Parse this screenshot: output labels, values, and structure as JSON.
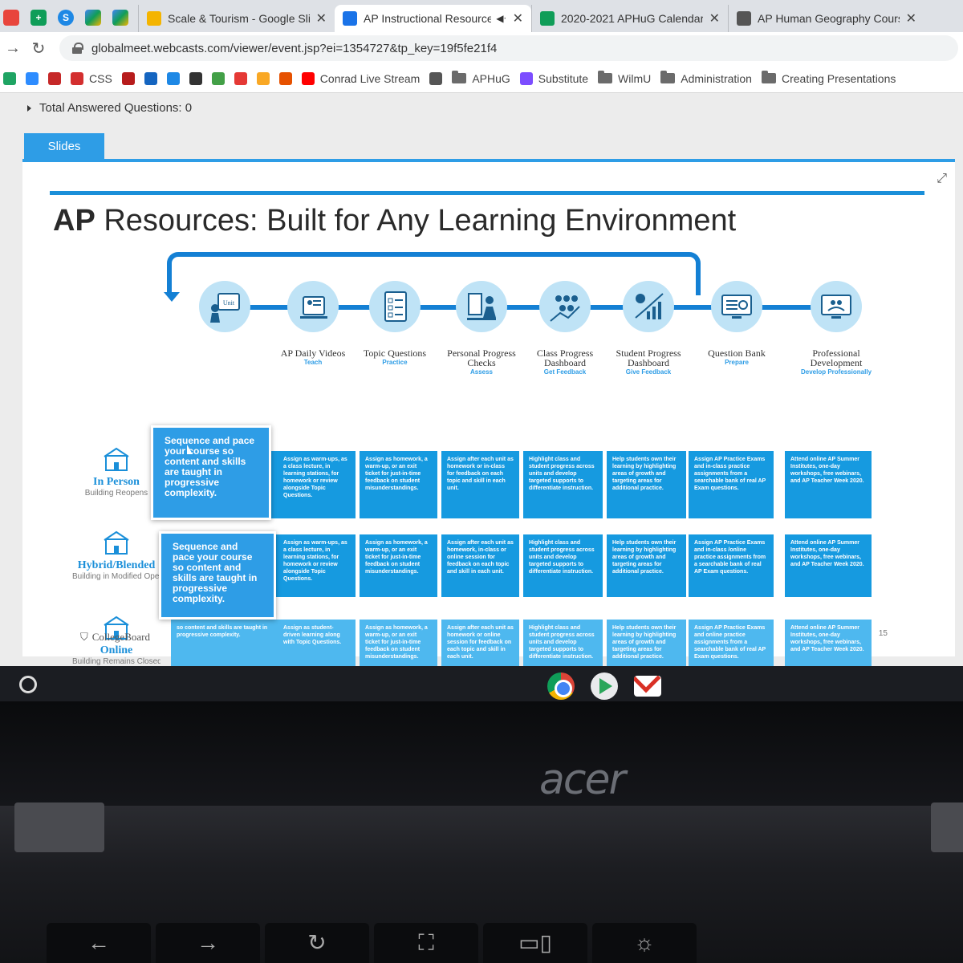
{
  "browser": {
    "tabs": [
      {
        "title": "Scale & Tourism - Google Slides",
        "icon": "slides-icon",
        "color": "#f4b400",
        "active": false
      },
      {
        "title": "AP Instructional Resources",
        "icon": "wifi-icon",
        "color": "#1a73e8",
        "active": true
      },
      {
        "title": "2020-2021 APHuG Calendar",
        "icon": "sheets-icon",
        "color": "#0f9d58",
        "active": false
      },
      {
        "title": "AP Human Geography Course",
        "icon": "collegeboard-icon",
        "color": "#555555",
        "active": false
      }
    ],
    "url": "globalmeet.webcasts.com/viewer/event.jsp?ei=1354727&tp_key=19f5fe21f4",
    "bookmarks": [
      {
        "label": "",
        "icon": "drive-icon",
        "color": "#1fa463"
      },
      {
        "label": "",
        "icon": "zoom-icon",
        "color": "#2d8cff"
      },
      {
        "label": "",
        "icon": "dlc-icon",
        "color": "#c62828"
      },
      {
        "label": "CSS",
        "icon": "home-icon",
        "color": "#d32f2f"
      },
      {
        "label": "",
        "icon": "news-icon",
        "color": "#b71c1c"
      },
      {
        "label": "",
        "icon": "calendar-icon",
        "color": "#1565c0"
      },
      {
        "label": "",
        "icon": "chart-icon",
        "color": "#1e88e5"
      },
      {
        "label": "",
        "icon": "pen-icon",
        "color": "#333333"
      },
      {
        "label": "",
        "icon": "plus-icon",
        "color": "#43a047"
      },
      {
        "label": "",
        "icon": "openai-icon",
        "color": "#e53935"
      },
      {
        "label": "",
        "icon": "bear-icon",
        "color": "#f9a825"
      },
      {
        "label": "",
        "icon": "daily-icon",
        "color": "#e65100"
      },
      {
        "label": "Conrad Live Stream",
        "icon": "youtube-icon",
        "color": "#ff0000"
      },
      {
        "label": "",
        "icon": "collegeboard-icon",
        "color": "#555555"
      },
      {
        "label": "APHuG",
        "icon": "folder-icon",
        "color": "#6b6b6b"
      },
      {
        "label": "Substitute",
        "icon": "substitute-icon",
        "color": "#7c4dff"
      },
      {
        "label": "WilmU",
        "icon": "folder-icon",
        "color": "#6b6b6b"
      },
      {
        "label": "Administration",
        "icon": "folder-icon",
        "color": "#6b6b6b"
      },
      {
        "label": "Creating Presentations",
        "icon": "folder-icon",
        "color": "#6b6b6b"
      }
    ]
  },
  "viewer": {
    "answered_label": "Total Answered Questions:",
    "answered_count": "0",
    "slides_tab": "Slides"
  },
  "slide": {
    "title_bold": "AP",
    "title_rest": " Resources: Built for Any Learning Environment",
    "accent": "#1480d4",
    "columns": [
      {
        "title": "",
        "sub": "",
        "icon": "unit-icon"
      },
      {
        "title": "AP Daily Videos",
        "sub": "Teach",
        "icon": "video-icon"
      },
      {
        "title": "Topic Questions",
        "sub": "Practice",
        "icon": "checklist-icon"
      },
      {
        "title": "Personal Progress Checks",
        "sub": "Assess",
        "icon": "student-laptop-icon"
      },
      {
        "title": "Class Progress Dashboard",
        "sub": "Get Feedback",
        "icon": "class-group-icon"
      },
      {
        "title": "Student Progress Dashboard",
        "sub": "Give Feedback",
        "icon": "growth-chart-icon"
      },
      {
        "title": "Question Bank",
        "sub": "Prepare",
        "icon": "search-monitor-icon"
      },
      {
        "title": "Professional Development",
        "sub": "Develop Professionally",
        "icon": "webinar-icon"
      }
    ],
    "rows": [
      {
        "name": "In Person",
        "sub": "Building Reopens",
        "cells": [
          "Sequence and pace your course so content and skills are taught in progressive complexity.",
          "Assign as warm-ups, as a class lecture, in learning stations, for homework or review alongside Topic Questions.",
          "Assign as homework, a warm-up, or an exit ticket for just-in-time feedback on student misunderstandings.",
          "Assign after each unit as homework or in-class for feedback on each topic and skill in each unit.",
          "Highlight class and student progress across units and develop targeted supports to differentiate instruction.",
          "Help students own their learning by highlighting areas of growth and targeting areas for additional practice.",
          "Assign AP Practice Exams and in-class practice assignments from a searchable bank of real AP Exam questions.",
          "Attend online AP Summer Institutes, one-day workshops, free webinars, and AP Teacher Week 2020."
        ]
      },
      {
        "name": "Hybrid/Blended",
        "sub": "Building in Modified Operation",
        "cells": [
          "Sequence and pace your course so content and skills are taught in progressive complexity.",
          "Assign as warm-ups, as a class lecture, in learning stations, for homework or review alongside Topic Questions.",
          "Assign as homework, a warm-up, or an exit ticket for just-in-time feedback on student misunderstandings.",
          "Assign after each unit as homework, in-class or online session for feedback on each topic and skill in each unit.",
          "Highlight class and student progress across units and develop targeted supports to differentiate instruction.",
          "Help students own their learning by highlighting areas of growth and targeting areas for additional practice.",
          "Assign AP Practice Exams and in-class /online practice assignments from a searchable bank of real AP Exam questions.",
          "Attend online AP Summer Institutes, one-day workshops, free webinars, and AP Teacher Week 2020."
        ]
      },
      {
        "name": "Online",
        "sub": "Building Remains Closed",
        "cells": [
          "so content and skills are taught in progressive complexity.",
          "Assign as student-driven learning along with Topic Questions.",
          "Assign as homework, a warm-up, or an exit ticket for just-in-time feedback on student misunderstandings.",
          "Assign after each unit as homework or online session for feedback on each topic and skill in each unit.",
          "Highlight class and student progress across units and develop targeted supports to differentiate instruction.",
          "Help students own their learning by highlighting areas of growth and targeting areas for additional practice.",
          "Assign AP Practice Exams and online practice assignments from a searchable bank of real AP Exam questions.",
          "Attend online AP Summer Institutes, one-day workshops, free webinars, and AP Teacher Week 2020."
        ]
      }
    ],
    "popups": [
      "Sequence and pace your course so content and skills are taught in progressive complexity.",
      "Sequence and pace your course so content and skills are taught in progressive complexity."
    ],
    "logo": "CollegeBoard",
    "page_number": "15"
  },
  "laptop": {
    "brand": "acer",
    "keys": [
      "←",
      "→",
      "↻",
      "⛶",
      "▭▯",
      "☼"
    ]
  }
}
